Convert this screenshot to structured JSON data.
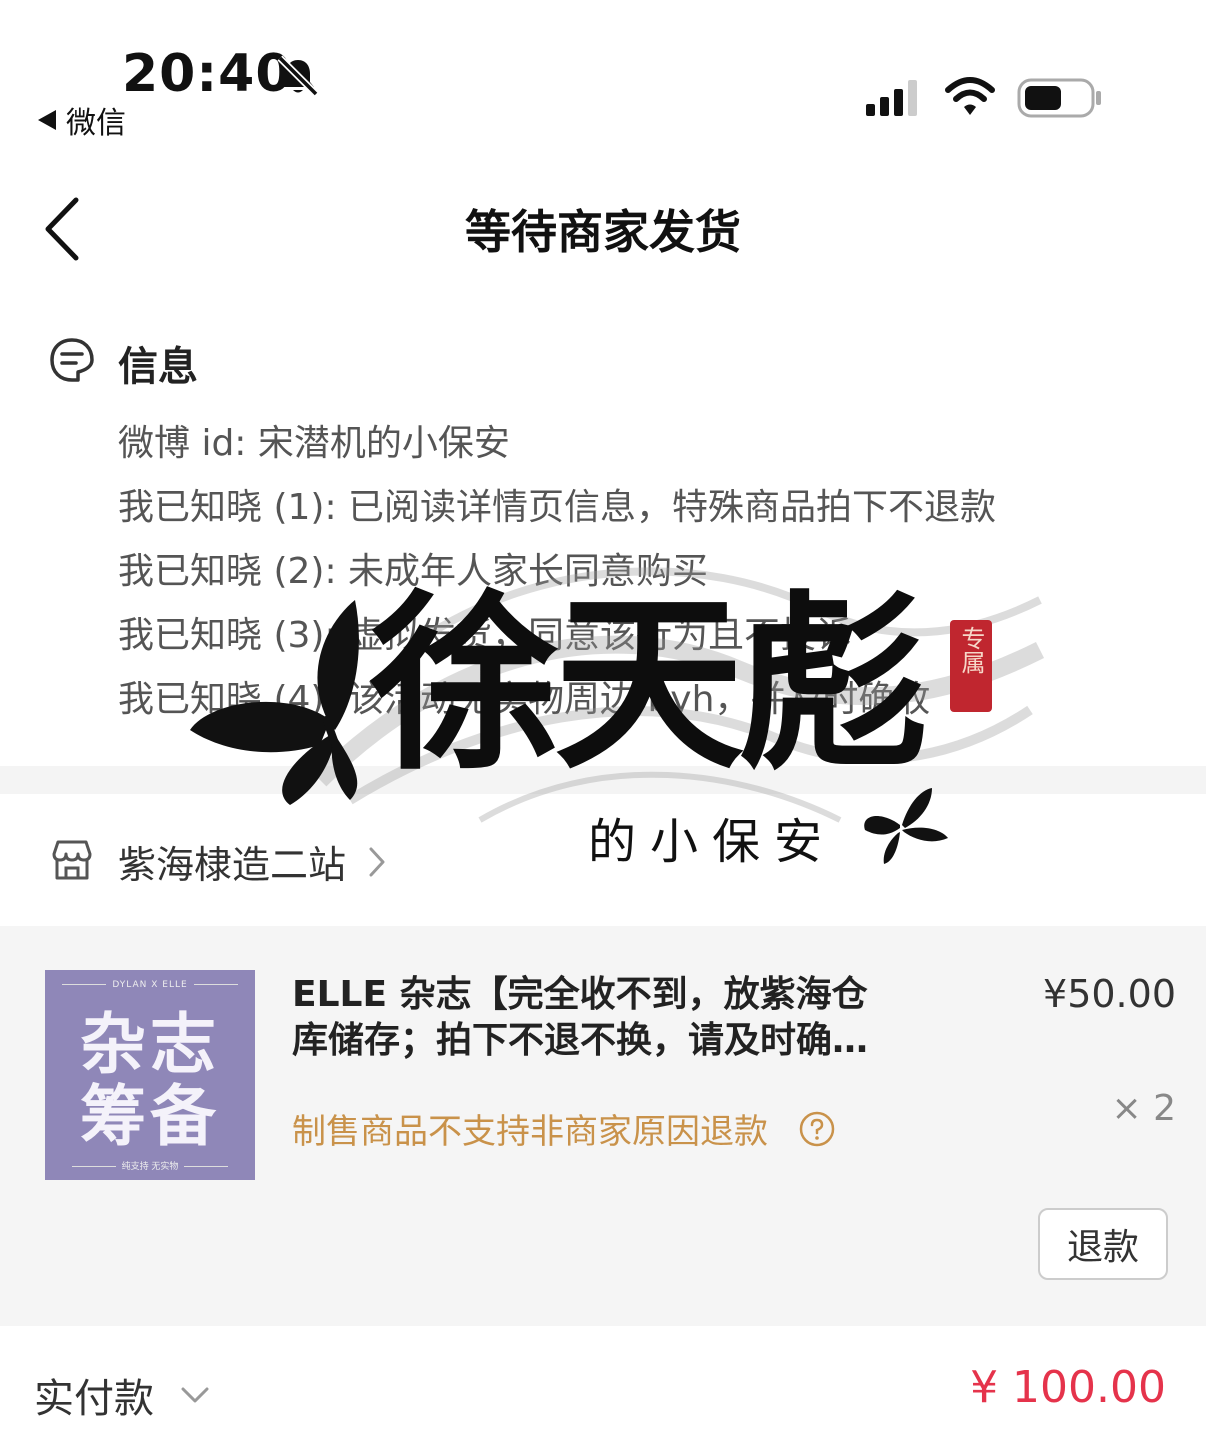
{
  "status_bar": {
    "time": "20:40",
    "back_app": "微信",
    "icons": [
      "bell-slash-icon",
      "signal-icon",
      "wifi-icon",
      "battery-icon"
    ]
  },
  "nav": {
    "title": "等待商家发货",
    "back_icon": "chevron-left-icon"
  },
  "info": {
    "title": "信息",
    "lines": [
      "微博 id: 宋潜机的小保安",
      "我已知晓 (1): 已阅读详情页信息，特殊商品拍下不退款",
      "我已知晓 (2): 未成年人家长同意购买",
      "我已知晓 (3): 虚拟发货，同意该行为且不投诉",
      "我已知晓 (4): 该活动无实物周边 byh，并及时确收"
    ]
  },
  "shop": {
    "name": "紫海棣造二站"
  },
  "product": {
    "thumb_top": "DYLAN X ELLE",
    "thumb_line1": "杂志",
    "thumb_line2": "筹备",
    "thumb_bottom": "纯支持 无实物",
    "title": "ELLE 杂志【完全收不到，放紫海仓库储存；拍下不退不换，请及时确收】",
    "notice": "制售商品不支持非商家原因退款",
    "price": "¥50.00",
    "quantity": "× 2",
    "refund_label": "退款"
  },
  "total": {
    "label": "实付款",
    "amount": "¥ 100.00"
  },
  "watermark": {
    "main_text": "徐天彪",
    "sub_text": "的小保安",
    "seal_text": "专属"
  },
  "colors": {
    "price_red": "#e5334b",
    "notice_orange": "#c9924a",
    "thumb_purple": "#8f87b8"
  }
}
